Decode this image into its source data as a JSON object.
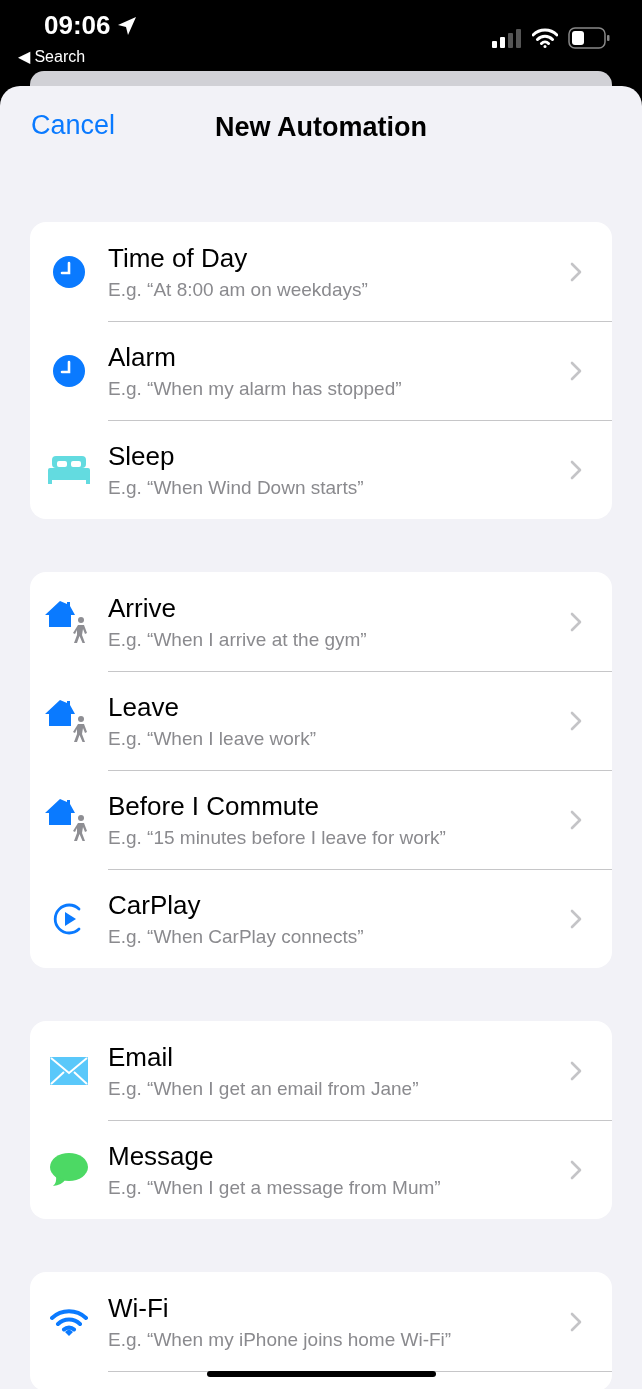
{
  "status_bar": {
    "time": "09:06",
    "back": "◀ Search"
  },
  "nav": {
    "cancel": "Cancel",
    "title": "New Automation"
  },
  "groups": [
    {
      "items": [
        {
          "kind": "clock",
          "title": "Time of Day",
          "subtitle": "E.g. “At 8:00 am on weekdays”"
        },
        {
          "kind": "clock",
          "title": "Alarm",
          "subtitle": "E.g. “When my alarm has stopped”"
        },
        {
          "kind": "bed",
          "title": "Sleep",
          "subtitle": "E.g. “When Wind Down starts”"
        }
      ]
    },
    {
      "items": [
        {
          "kind": "home",
          "title": "Arrive",
          "subtitle": "E.g. “When I arrive at the gym”"
        },
        {
          "kind": "home",
          "title": "Leave",
          "subtitle": "E.g. “When I leave work”"
        },
        {
          "kind": "home",
          "title": "Before I Commute",
          "subtitle": "E.g. “15 minutes before I leave for work”"
        },
        {
          "kind": "carplay",
          "title": "CarPlay",
          "subtitle": "E.g. “When CarPlay connects”"
        }
      ]
    },
    {
      "items": [
        {
          "kind": "mail",
          "title": "Email",
          "subtitle": "E.g. “When I get an email from Jane”"
        },
        {
          "kind": "message",
          "title": "Message",
          "subtitle": "E.g. “When I get a message from Mum”"
        }
      ]
    },
    {
      "items": [
        {
          "kind": "wifi",
          "title": "Wi-Fi",
          "subtitle": "E.g. “When my iPhone joins home Wi-Fi”"
        }
      ]
    }
  ]
}
